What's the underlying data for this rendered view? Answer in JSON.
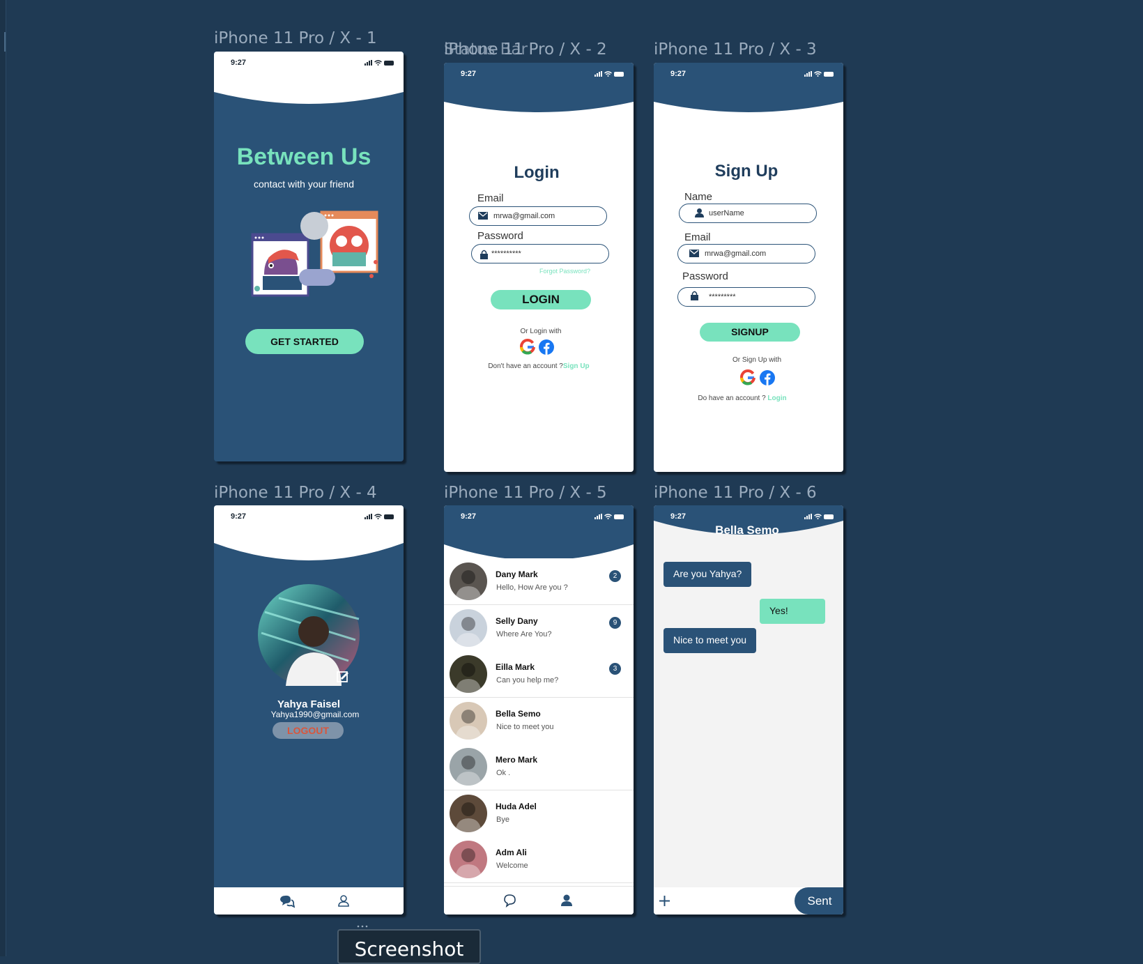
{
  "frame_labels": {
    "f1": "iPhone 11 Pro / X - 1",
    "f2": "iPhone 11 Pro / X - 2",
    "f2_overlay": "Status Bar",
    "f3": "iPhone 11 Pro / X - 3",
    "f4": "iPhone 11 Pro / X - 4",
    "f5": "iPhone 11 Pro / X - 5",
    "f6": "iPhone 11 Pro / X - 6"
  },
  "status_time": "9:27",
  "welcome": {
    "title": "Between Us",
    "subtitle": "contact with your friend",
    "cta": "GET STARTED"
  },
  "login": {
    "title": "Login",
    "email_label": "Email",
    "email_value": "mrwa@gmail.com",
    "password_label": "Password",
    "password_value": "**********",
    "forgot": "Forgot Password?",
    "button": "LOGIN",
    "or_text": "Or Login with",
    "no_account": "Don't have an account ?",
    "signup_link": "Sign Up"
  },
  "signup": {
    "title": "Sign Up",
    "name_label": "Name",
    "name_value": "userName",
    "email_label": "Email",
    "email_value": "mrwa@gmail.com",
    "password_label": "Password",
    "password_value": "*********",
    "button": "SIGNUP",
    "or_text": "Or Sign Up with",
    "have_account": "Do have an account ?",
    "login_link": "Login"
  },
  "profile": {
    "name": "Yahya Faisel",
    "email": "Yahya1990@gmail.com",
    "logout": "LOGOUT"
  },
  "chats": [
    {
      "name": "Dany Mark",
      "message": "Hello, How Are you ?",
      "badge": "2",
      "color": "#5a5550"
    },
    {
      "name": "Selly Dany",
      "message": "Where Are You?",
      "badge": "9",
      "color": "#c9d2dc"
    },
    {
      "name": "Eilla Mark",
      "message": "Can you help me?",
      "badge": "3",
      "color": "#3b3a2a"
    },
    {
      "name": "Bella Semo",
      "message": "Nice to meet you",
      "badge": "",
      "color": "#d8c8b6"
    },
    {
      "name": "Mero Mark",
      "message": "Ok .",
      "badge": "",
      "color": "#9aa4a8"
    },
    {
      "name": "Huda Adel",
      "message": "Bye",
      "badge": "",
      "color": "#5d4a3a"
    },
    {
      "name": "Adm Ali",
      "message": "Welcome",
      "badge": "",
      "color": "#c07880"
    }
  ],
  "conversation": {
    "contact": "Bella Semo",
    "messages": [
      {
        "text": "Are you Yahya?",
        "from": "them"
      },
      {
        "text": "Yes!",
        "from": "me"
      },
      {
        "text": "Nice to meet you",
        "from": "them"
      }
    ],
    "send": "Sent"
  },
  "tooltip": "Screenshot",
  "colors": {
    "navy": "#2a5277",
    "mint": "#78e2bd",
    "canvas": "#1f3a54"
  }
}
